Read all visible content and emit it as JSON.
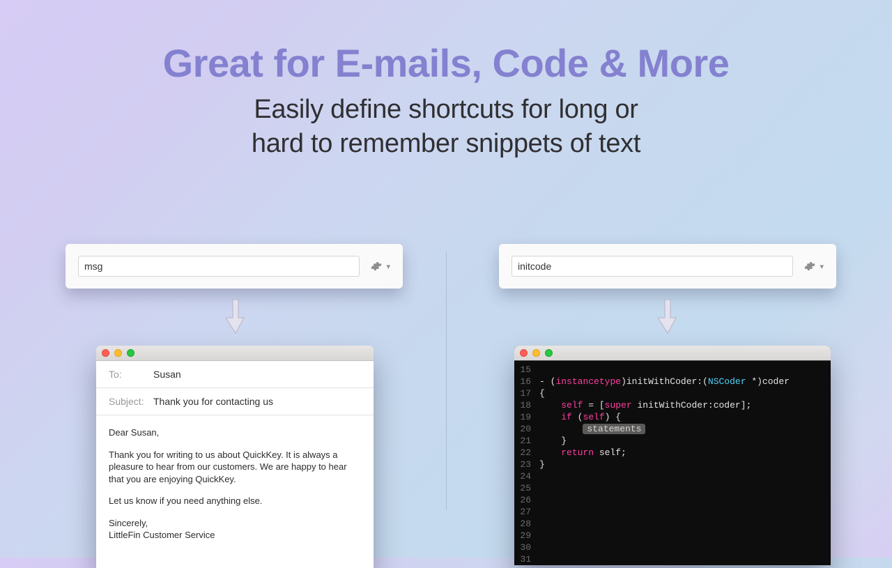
{
  "headline": "Great for E-mails, Code & More",
  "subhead_line1": "Easily define shortcuts for long or",
  "subhead_line2": "hard to remember snippets of text",
  "left": {
    "command": "msg",
    "email": {
      "to_label": "To:",
      "to_value": "Susan",
      "subject_label": "Subject:",
      "subject_value": "Thank you for contacting us",
      "greeting": "Dear Susan,",
      "para1": "Thank you for writing to us about QuickKey. It is always a pleasure to hear from our customers. We are happy to hear that you are enjoying QuickKey.",
      "para2": "Let us know if you need anything else.",
      "signoff1": "Sincerely,",
      "signoff2": "LittleFin Customer Service"
    }
  },
  "right": {
    "command": "initcode",
    "code": {
      "line_start": 15,
      "line_end": 31,
      "tokens": {
        "dash": "-",
        "lparen": "(",
        "rparen": ")",
        "instanceType": "instancetype",
        "initWithCoder": "initWithCoder:",
        "nscoder": "NSCoder",
        "starcoder": " *)coder",
        "lbrace": "{",
        "rbrace": "}",
        "self": "self",
        "eq": " = [",
        "super": "super",
        "call": " initWithCoder:coder];",
        "if": "if",
        "cond_open": " (",
        "cond_close": ") {",
        "placeholder": "statements",
        "return": "return",
        "ret_end": " self;"
      }
    }
  }
}
